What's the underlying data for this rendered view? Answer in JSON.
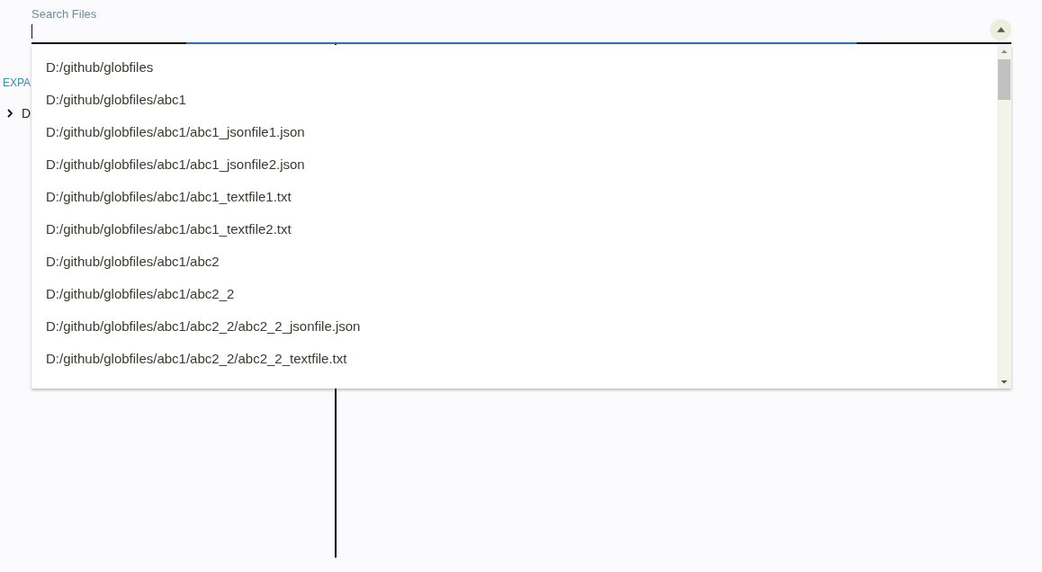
{
  "search": {
    "label": "Search Files",
    "focused": true,
    "open": true
  },
  "toolbar": {
    "button": "EXPA"
  },
  "tree": [
    {
      "label": "D",
      "expanded": false
    }
  ],
  "results": [
    "D:/github/globfiles",
    "D:/github/globfiles/abc1",
    "D:/github/globfiles/abc1/abc1_jsonfile1.json",
    "D:/github/globfiles/abc1/abc1_jsonfile2.json",
    "D:/github/globfiles/abc1/abc1_textfile1.txt",
    "D:/github/globfiles/abc1/abc1_textfile2.txt",
    "D:/github/globfiles/abc1/abc2",
    "D:/github/globfiles/abc1/abc2_2",
    "D:/github/globfiles/abc1/abc2_2/abc2_2_jsonfile.json",
    "D:/github/globfiles/abc1/abc2_2/abc2_2_textfile.txt"
  ]
}
